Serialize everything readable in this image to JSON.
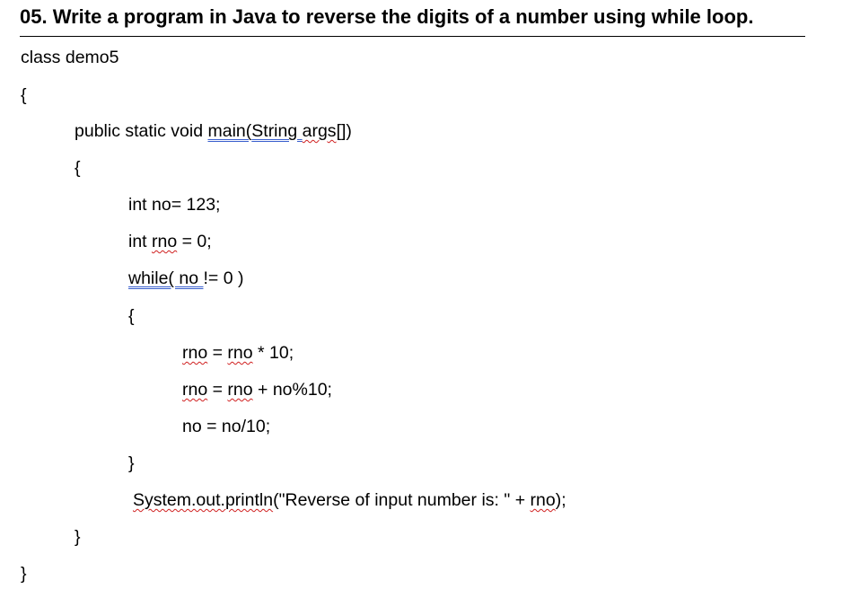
{
  "heading": "05. Write a program in Java to reverse the digits of a number using while loop.",
  "code": {
    "l1": "class demo5",
    "l2": "{",
    "l3_pre": "public static void ",
    "l3_main": "main(",
    "l3_string": "String ",
    "l3_args": "args",
    "l3_post": "[])",
    "l4": "{",
    "l5": "int no= 123;",
    "l6_pre": "int ",
    "l6_rno": "rno",
    "l6_post": " = 0;",
    "l7_while": "while( no ",
    "l7_post": "!= 0 )",
    "l8": "{",
    "l9_a": "rno",
    "l9_mid": " = ",
    "l9_b": "rno",
    "l9_post": " * 10;",
    "l10_a": "rno",
    "l10_mid": " = ",
    "l10_b": "rno",
    "l10_post": " + no%10;",
    "l11": "no = no/10;",
    "l12": "}",
    "l13_sys": "System.out.println",
    "l13_mid": "(\"Reverse of input number is: \" + ",
    "l13_rno": "rno",
    "l13_post": ");",
    "l14": "}",
    "l15": "}"
  }
}
